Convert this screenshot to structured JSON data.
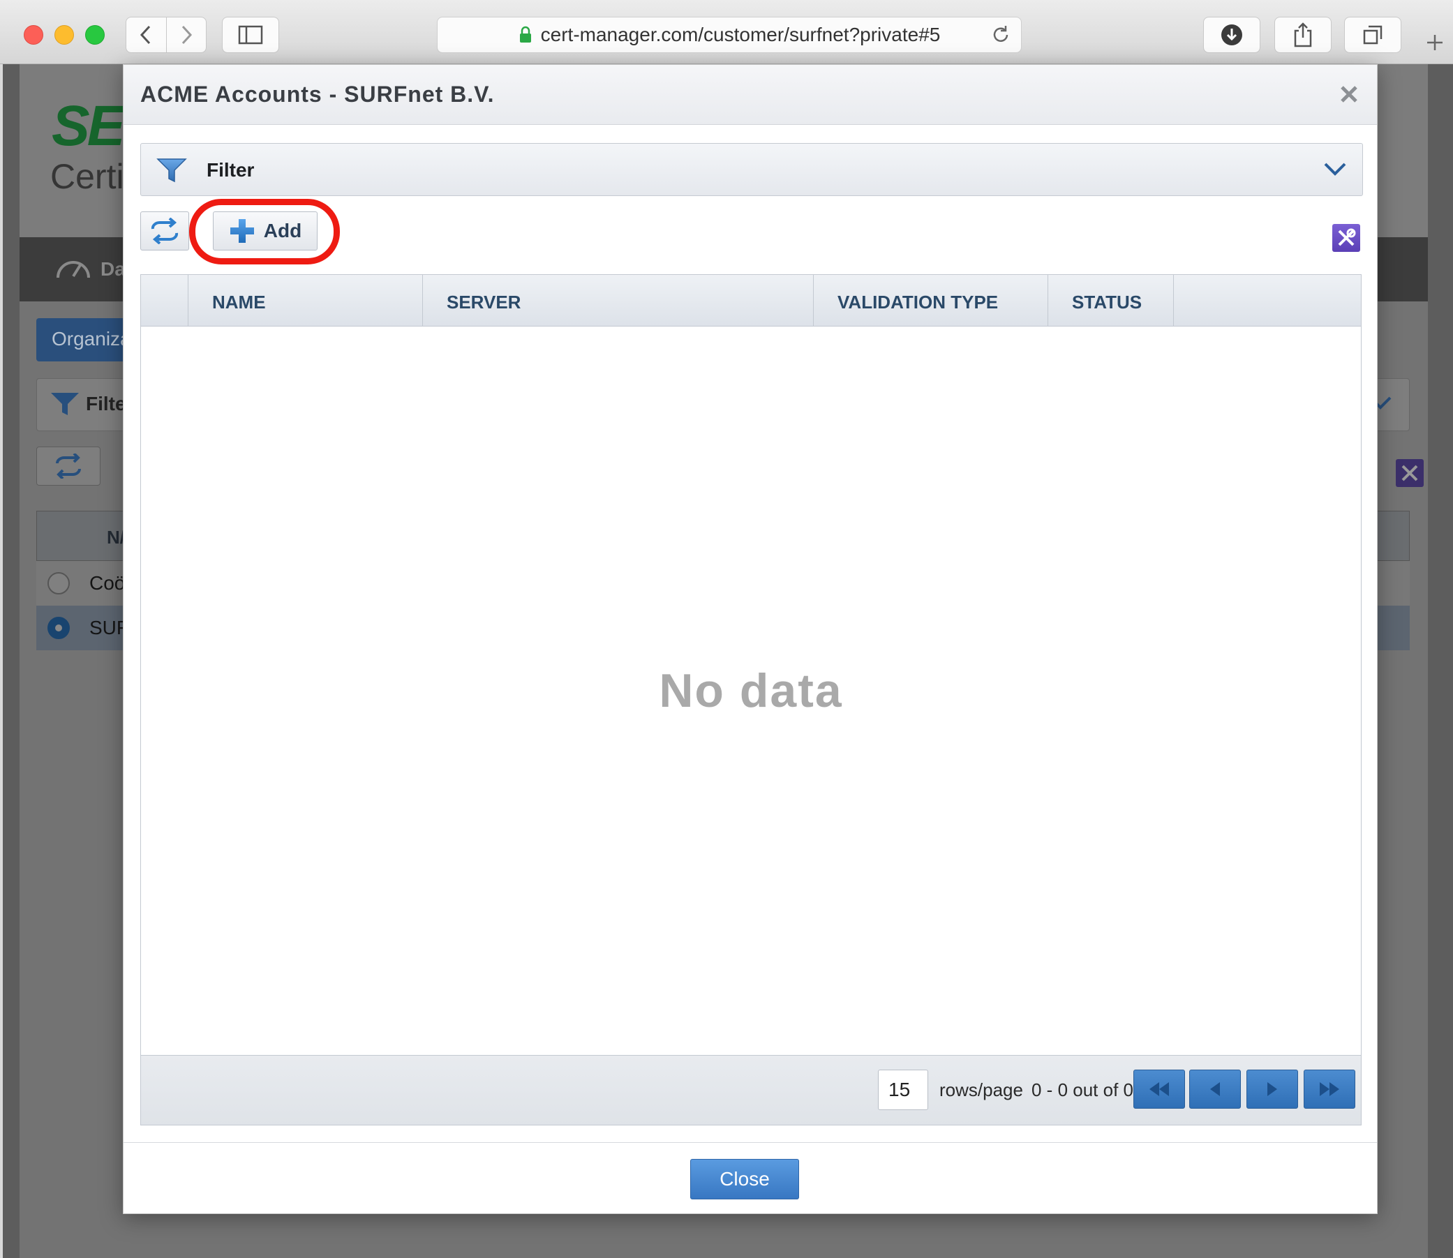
{
  "browser": {
    "url": "cert-manager.com/customer/surfnet?private#5"
  },
  "background_page": {
    "logo_text": "SE",
    "subtitle": "Certi",
    "nav_dashboard": "Da",
    "tab_label": "Organiza",
    "filter_label": "Filte",
    "table_header_name": "N/",
    "rows": [
      "Coö",
      "SUF"
    ]
  },
  "modal": {
    "title": "ACME Accounts - SURFnet B.V.",
    "filter_label": "Filter",
    "add_label": "Add",
    "columns": [
      "NAME",
      "SERVER",
      "VALIDATION TYPE",
      "STATUS"
    ],
    "empty_message": "No data",
    "pagination": {
      "rows_per_page": "15",
      "rows_label": "rows/page",
      "range_text": "0 - 0 out of 0"
    },
    "close_label": "Close"
  },
  "colors": {
    "highlight_ring": "#ee1b12",
    "accent_blue": "#3877c2",
    "tools_purple": "#5b3fb6",
    "header_text": "#2a4968"
  }
}
